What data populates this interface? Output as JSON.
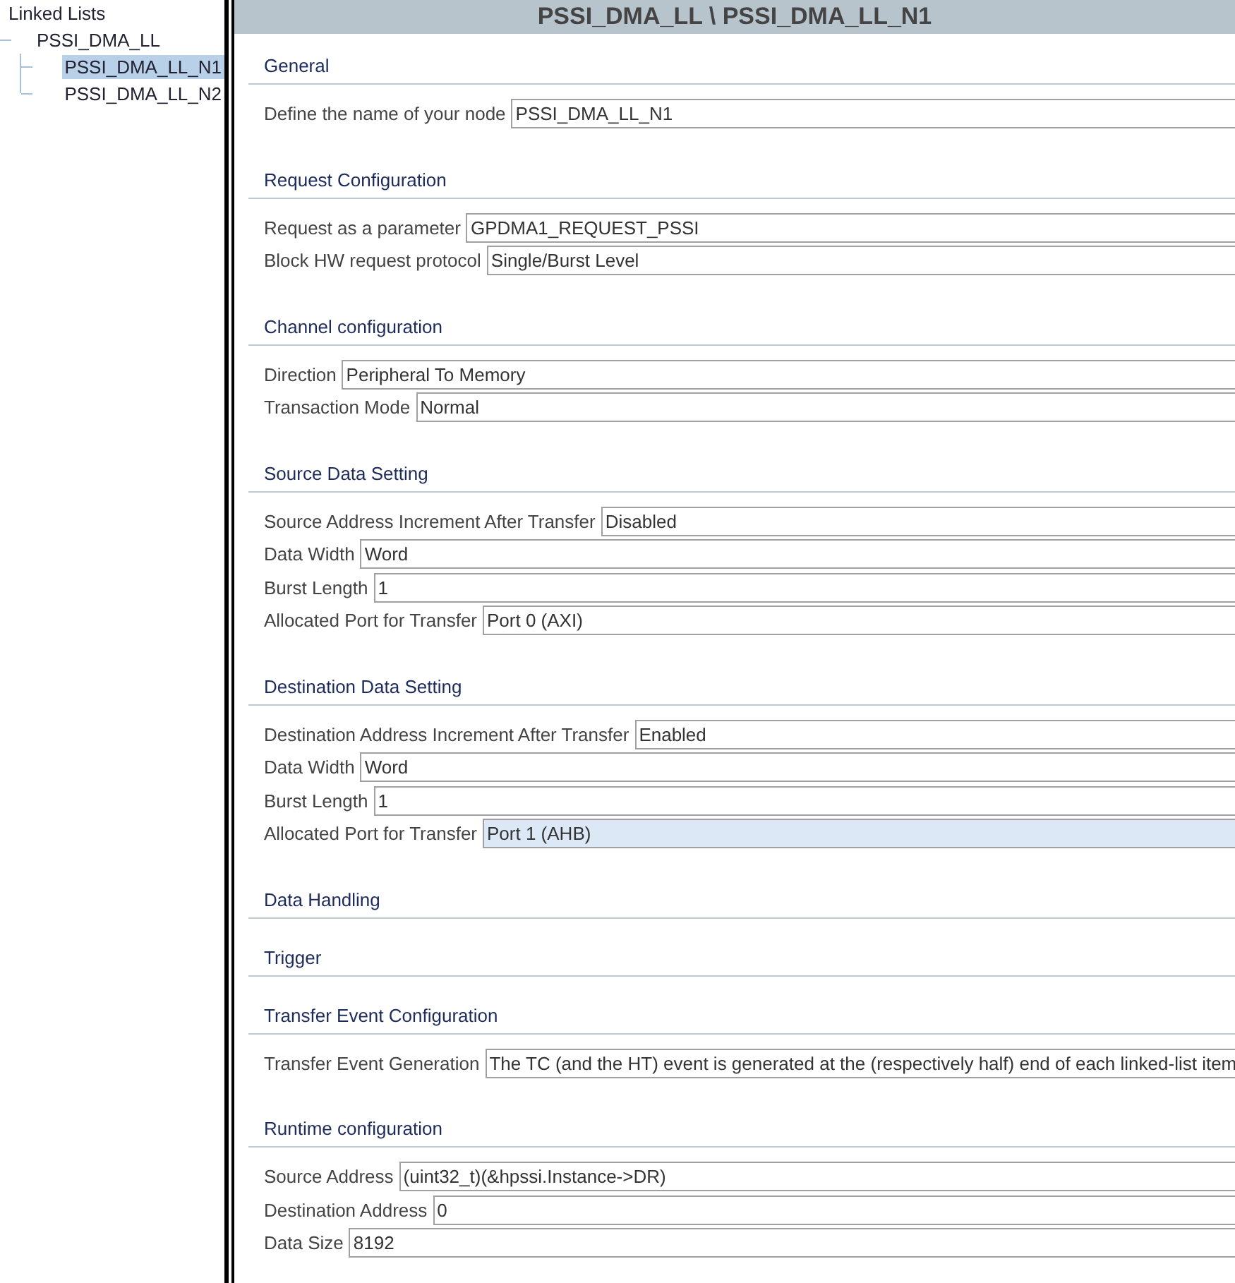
{
  "tree": {
    "title": "Linked Lists",
    "root": {
      "label": "PSSI_DMA_LL",
      "children": [
        {
          "label": "PSSI_DMA_LL_N1",
          "selected": true
        },
        {
          "label": "PSSI_DMA_LL_N2",
          "selected": false
        }
      ]
    }
  },
  "panel": {
    "title": "PSSI_DMA_LL \\ PSSI_DMA_LL_N1",
    "sections": [
      {
        "title": "General",
        "fields": [
          {
            "label": "Define the name of your node",
            "value": "PSSI_DMA_LL_N1",
            "selected": false
          }
        ]
      },
      {
        "title": "Request Configuration",
        "fields": [
          {
            "label": "Request as a parameter",
            "value": "GPDMA1_REQUEST_PSSI",
            "selected": false
          },
          {
            "label": "Block HW request protocol",
            "value": "Single/Burst Level",
            "selected": false
          }
        ]
      },
      {
        "title": "Channel configuration",
        "fields": [
          {
            "label": "Direction",
            "value": "Peripheral To Memory",
            "selected": false
          },
          {
            "label": "Transaction Mode",
            "value": "Normal",
            "selected": false
          }
        ]
      },
      {
        "title": "Source Data Setting",
        "fields": [
          {
            "label": "Source Address Increment After Transfer",
            "value": "Disabled",
            "selected": false
          },
          {
            "label": "Data Width",
            "value": "Word",
            "selected": false
          },
          {
            "label": "Burst Length",
            "value": "1",
            "selected": false
          },
          {
            "label": "Allocated Port for Transfer",
            "value": "Port 0 (AXI)",
            "selected": false
          }
        ]
      },
      {
        "title": "Destination Data Setting",
        "fields": [
          {
            "label": "Destination Address Increment After Transfer",
            "value": "Enabled",
            "selected": false
          },
          {
            "label": "Data Width",
            "value": "Word",
            "selected": false
          },
          {
            "label": "Burst Length",
            "value": "1",
            "selected": false
          },
          {
            "label": "Allocated Port for Transfer",
            "value": "Port 1 (AHB)",
            "selected": true
          }
        ]
      },
      {
        "title": "Data Handling"
      },
      {
        "title": "Trigger"
      },
      {
        "title": "Transfer Event Configuration",
        "fields": [
          {
            "label": "Transfer Event Generation",
            "value": "The TC (and the HT) event is generated at the (respectively half) end of each linked-list item",
            "selected": false
          }
        ]
      },
      {
        "title": "Runtime configuration",
        "fields": [
          {
            "label": "Source Address",
            "value": "(uint32_t)(&hpssi.Instance->DR)",
            "selected": false
          },
          {
            "label": "Destination Address",
            "value": "0",
            "selected": false
          },
          {
            "label": "Data Size",
            "value": "8192",
            "selected": false
          }
        ]
      }
    ]
  }
}
